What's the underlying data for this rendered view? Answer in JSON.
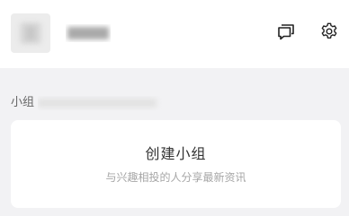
{
  "header": {
    "chat_icon": "chat-bubbles-icon",
    "settings_icon": "gear-icon"
  },
  "groups_section": {
    "label": "小组"
  },
  "create_group_card": {
    "title": "创建小组",
    "subtitle": "与兴趣相投的人分享最新资讯"
  },
  "colors": {
    "background": "#f2f2f4",
    "card": "#ffffff",
    "title_text": "#333333",
    "subtitle_text": "#a6a6a6",
    "icon_stroke": "#222222"
  }
}
